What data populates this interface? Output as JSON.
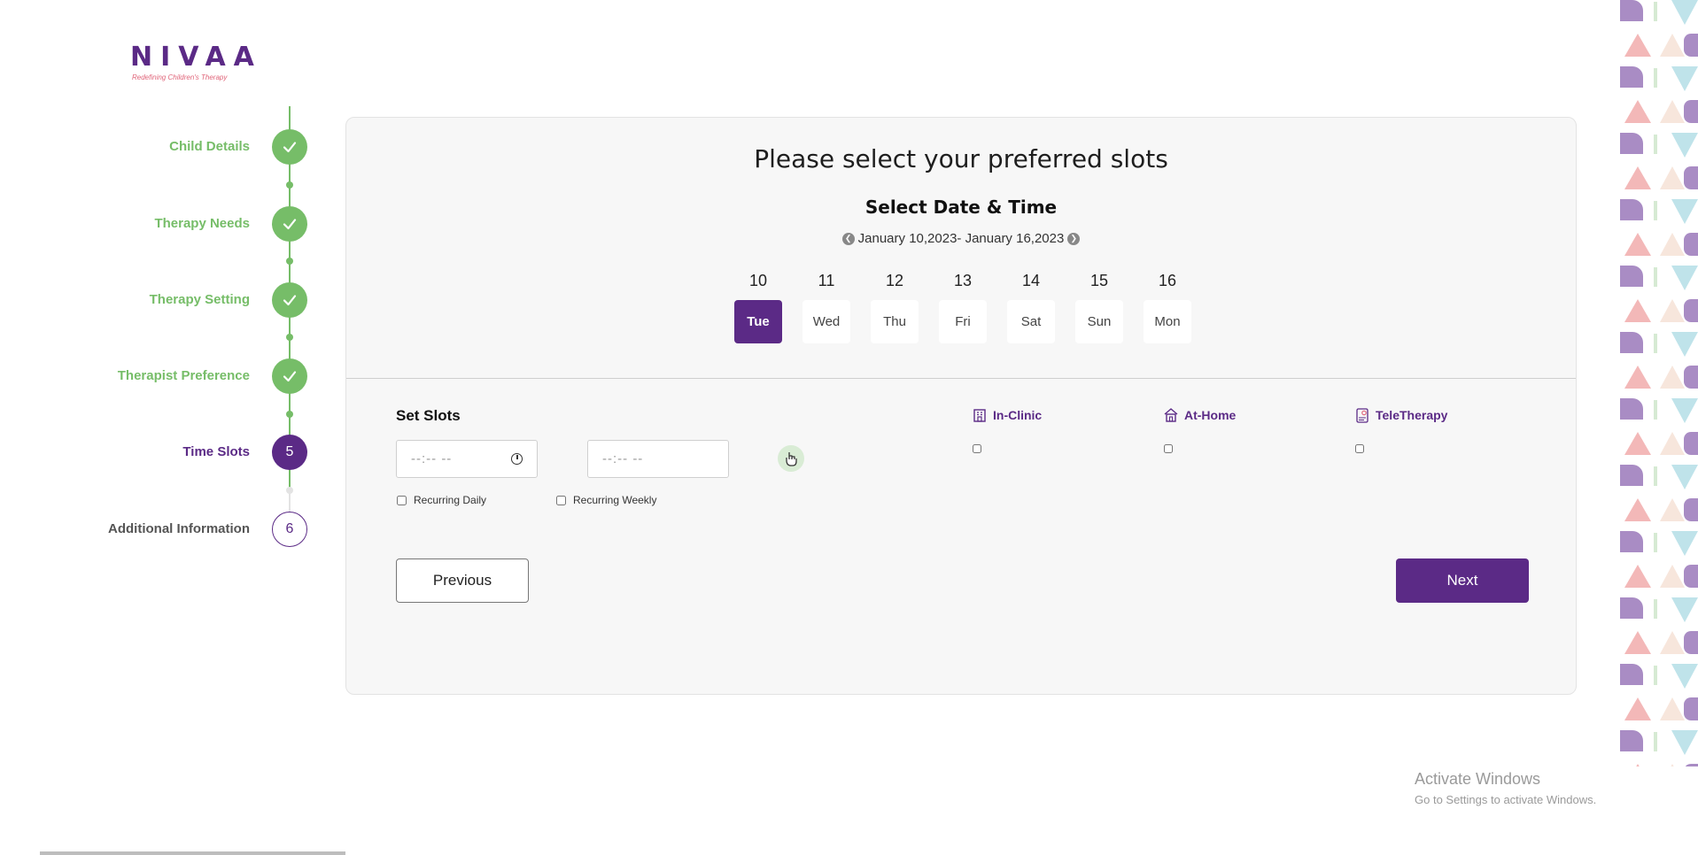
{
  "brand": {
    "name": "NIVAA",
    "tagline": "Redefining Children's Therapy",
    "primary_color": "#5b2a86",
    "done_color": "#76bd68"
  },
  "stepper": [
    {
      "label": "Child Details",
      "state": "done",
      "marker": "check-icon"
    },
    {
      "label": "Therapy Needs",
      "state": "done",
      "marker": "check-icon"
    },
    {
      "label": "Therapy Setting",
      "state": "done",
      "marker": "check-icon"
    },
    {
      "label": "Therapist Preference",
      "state": "done",
      "marker": "check-icon"
    },
    {
      "label": "Time Slots",
      "state": "active",
      "number": "5"
    },
    {
      "label": "Additional Information",
      "state": "todo",
      "number": "6"
    }
  ],
  "card": {
    "title": "Please select your preferred slots",
    "subtitle": "Select Date & Time",
    "date_range": "January 10,2023- January 16,2023",
    "days": [
      {
        "num": "10",
        "name": "Tue",
        "selected": true
      },
      {
        "num": "11",
        "name": "Wed"
      },
      {
        "num": "12",
        "name": "Thu"
      },
      {
        "num": "13",
        "name": "Fri"
      },
      {
        "num": "14",
        "name": "Sat"
      },
      {
        "num": "15",
        "name": "Sun"
      },
      {
        "num": "16",
        "name": "Mon"
      }
    ],
    "slots": {
      "title": "Set Slots",
      "start_placeholder": "--:-- --",
      "end_placeholder": "--:-- --",
      "recurring_daily": "Recurring Daily",
      "recurring_weekly": "Recurring Weekly"
    },
    "modes": [
      {
        "label": "In-Clinic",
        "icon": "clinic-building-icon"
      },
      {
        "label": "At-Home",
        "icon": "home-icon"
      },
      {
        "label": "TeleTherapy",
        "icon": "teletherapy-icon"
      }
    ],
    "previous_label": "Previous",
    "next_label": "Next"
  },
  "watermark": {
    "line1": "Activate Windows",
    "line2": "Go to Settings to activate Windows."
  }
}
